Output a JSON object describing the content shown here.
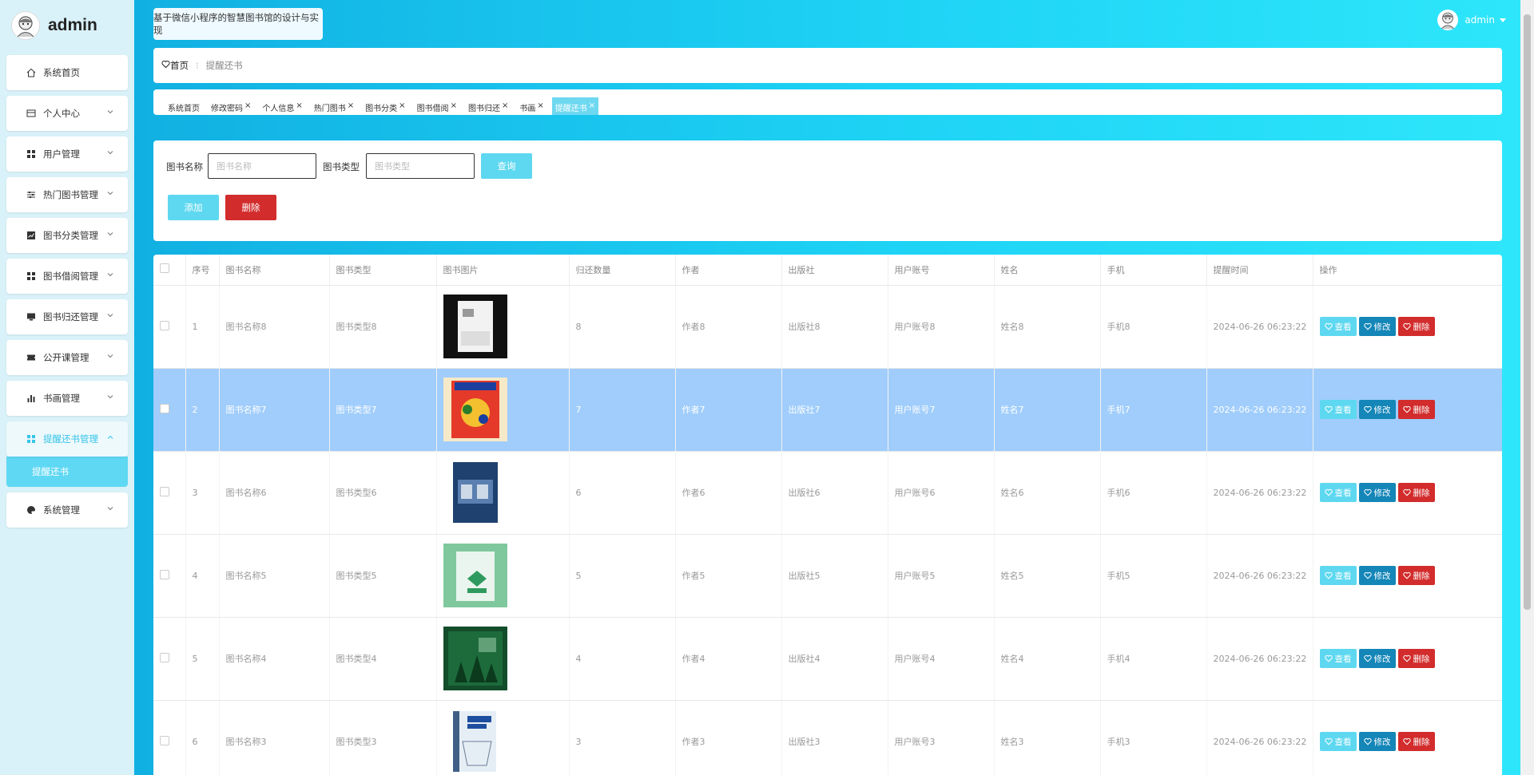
{
  "brand": {
    "name": "admin"
  },
  "site_title": "基于微信小程序的智慧图书馆的设计与实现",
  "user": {
    "name": "admin"
  },
  "sidebar": {
    "items": [
      {
        "label": "系统首页",
        "icon": "home-icon",
        "expandable": false
      },
      {
        "label": "个人中心",
        "icon": "card-icon",
        "expandable": true
      },
      {
        "label": "用户管理",
        "icon": "grid-icon",
        "expandable": true
      },
      {
        "label": "热门图书管理",
        "icon": "sliders-icon",
        "expandable": true
      },
      {
        "label": "图书分类管理",
        "icon": "chart-icon",
        "expandable": true
      },
      {
        "label": "图书借阅管理",
        "icon": "grid-icon",
        "expandable": true
      },
      {
        "label": "图书归还管理",
        "icon": "monitor-icon",
        "expandable": true
      },
      {
        "label": "公开课管理",
        "icon": "ticket-icon",
        "expandable": true
      },
      {
        "label": "书画管理",
        "icon": "bar-chart-icon",
        "expandable": true
      },
      {
        "label": "提醒还书管理",
        "icon": "grid-icon",
        "expandable": true,
        "active": true,
        "open": true
      },
      {
        "label": "系统管理",
        "icon": "palette-icon",
        "expandable": true
      }
    ],
    "submenu": {
      "label": "提醒还书"
    }
  },
  "breadcrumb": {
    "home": "首页",
    "current": "提醒还书"
  },
  "tags": [
    {
      "label": "系统首页",
      "closable": false
    },
    {
      "label": "修改密码",
      "closable": true
    },
    {
      "label": "个人信息",
      "closable": true
    },
    {
      "label": "热门图书",
      "closable": true
    },
    {
      "label": "图书分类",
      "closable": true
    },
    {
      "label": "图书借阅",
      "closable": true
    },
    {
      "label": "图书归还",
      "closable": true
    },
    {
      "label": "书画",
      "closable": true
    },
    {
      "label": "提醒还书",
      "closable": true,
      "active": true
    }
  ],
  "search": {
    "name_label": "图书名称",
    "name_placeholder": "图书名称",
    "type_label": "图书类型",
    "type_placeholder": "图书类型",
    "query_label": "查询",
    "add_label": "添加",
    "delete_label": "删除"
  },
  "table": {
    "columns": [
      "序号",
      "图书名称",
      "图书类型",
      "图书图片",
      "归还数量",
      "作者",
      "出版社",
      "用户账号",
      "姓名",
      "手机",
      "提醒时间",
      "操作"
    ],
    "action_labels": {
      "view": "查看",
      "edit": "修改",
      "delete": "删除"
    },
    "rows": [
      {
        "index": "1",
        "name": "图书名称8",
        "type": "图书类型8",
        "cover": "cover-white",
        "qty": "8",
        "author": "作者8",
        "publisher": "出版社8",
        "account": "用户账号8",
        "realname": "姓名8",
        "phone": "手机8",
        "time": "2024-06-26 06:23:22"
      },
      {
        "index": "2",
        "name": "图书名称7",
        "type": "图书类型7",
        "cover": "cover-red",
        "qty": "7",
        "author": "作者7",
        "publisher": "出版社7",
        "account": "用户账号7",
        "realname": "姓名7",
        "phone": "手机7",
        "time": "2024-06-26 06:23:22",
        "highlighted": true
      },
      {
        "index": "3",
        "name": "图书名称6",
        "type": "图书类型6",
        "cover": "cover-navy",
        "qty": "6",
        "author": "作者6",
        "publisher": "出版社6",
        "account": "用户账号6",
        "realname": "姓名6",
        "phone": "手机6",
        "time": "2024-06-26 06:23:22"
      },
      {
        "index": "4",
        "name": "图书名称5",
        "type": "图书类型5",
        "cover": "cover-green",
        "qty": "5",
        "author": "作者5",
        "publisher": "出版社5",
        "account": "用户账号5",
        "realname": "姓名5",
        "phone": "手机5",
        "time": "2024-06-26 06:23:22"
      },
      {
        "index": "5",
        "name": "图书名称4",
        "type": "图书类型4",
        "cover": "cover-forest",
        "qty": "4",
        "author": "作者4",
        "publisher": "出版社4",
        "account": "用户账号4",
        "realname": "姓名4",
        "phone": "手机4",
        "time": "2024-06-26 06:23:22"
      },
      {
        "index": "6",
        "name": "图书名称3",
        "type": "图书类型3",
        "cover": "cover-light",
        "qty": "3",
        "author": "作者3",
        "publisher": "出版社3",
        "account": "用户账号3",
        "realname": "姓名3",
        "phone": "手机3",
        "time": "2024-06-26 06:23:22"
      }
    ]
  },
  "colors": {
    "accent": "#5ed8f0",
    "danger": "#d22c2c",
    "edit": "#1486b8",
    "highlight_row": "#a0cdfb"
  }
}
